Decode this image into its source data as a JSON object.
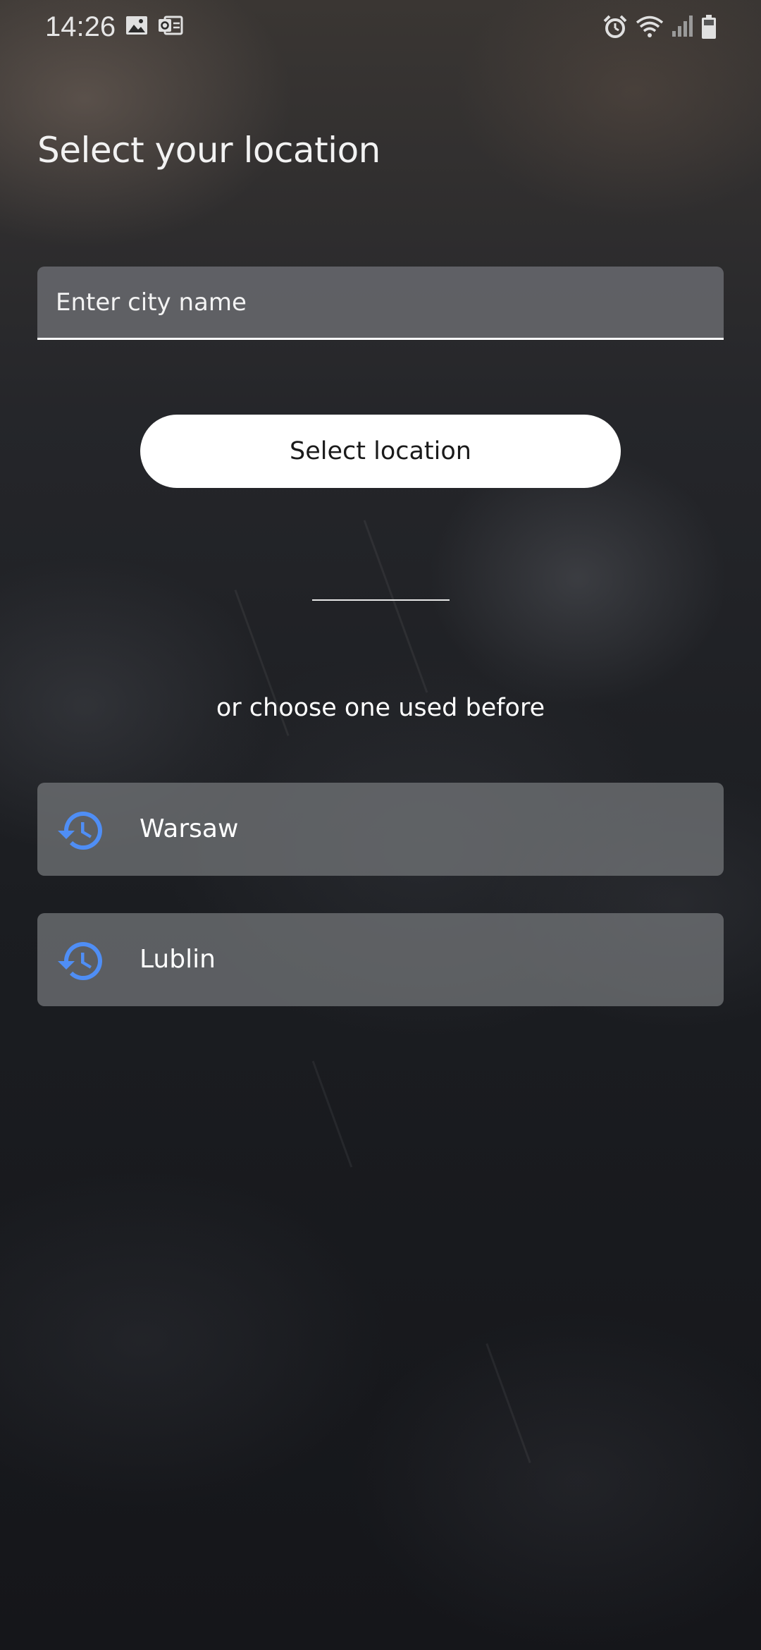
{
  "status_bar": {
    "time": "14:26",
    "icons": [
      "gallery-icon",
      "outlook-icon",
      "alarm-icon",
      "wifi-icon",
      "signal-icon",
      "battery-icon"
    ]
  },
  "page": {
    "title": "Select your location"
  },
  "search": {
    "placeholder": "Enter city name",
    "value": ""
  },
  "actions": {
    "select_label": "Select location"
  },
  "recent": {
    "heading": "or choose one used before",
    "items": [
      {
        "label": "Warsaw",
        "icon": "history-icon"
      },
      {
        "label": "Lublin",
        "icon": "history-icon"
      }
    ]
  },
  "colors": {
    "accent": "#4f8ef5",
    "button_bg": "#ffffff",
    "card_bg": "#76787c"
  }
}
